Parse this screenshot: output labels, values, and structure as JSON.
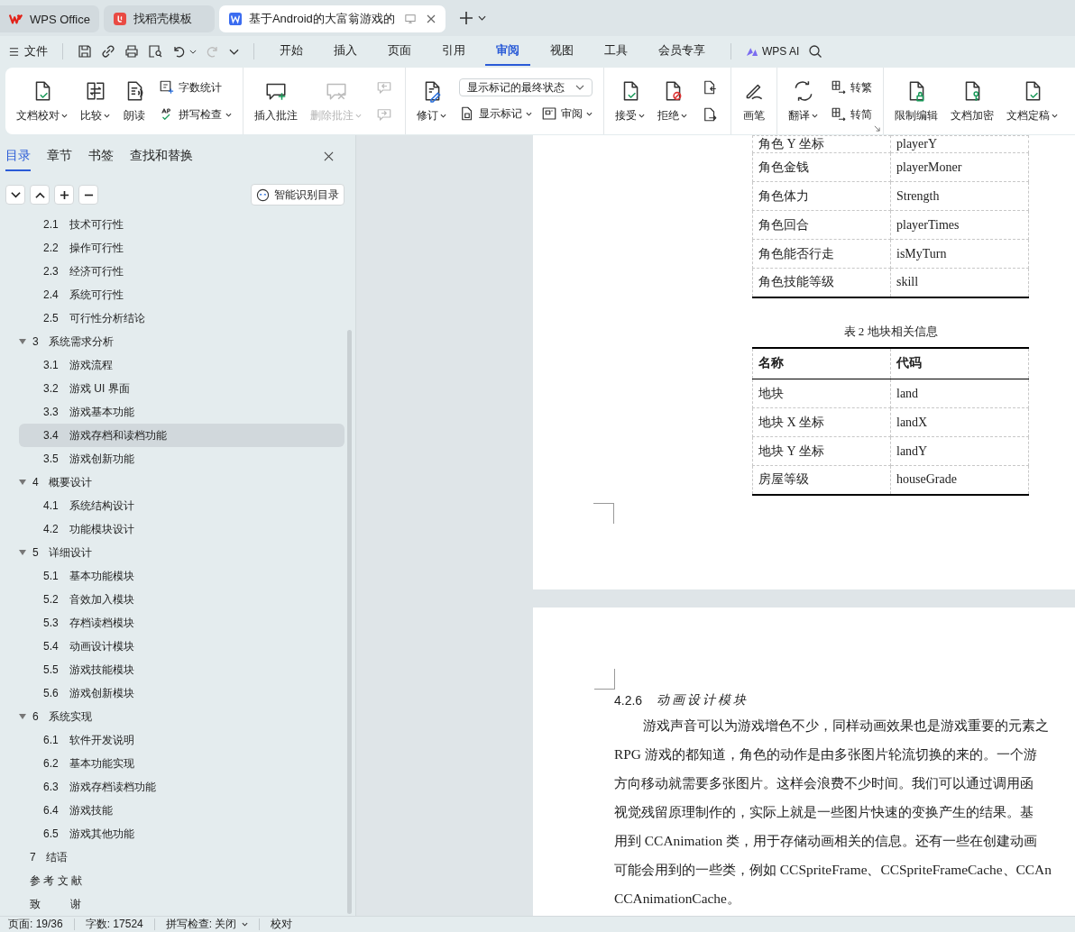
{
  "title_bar": {
    "tabs": [
      {
        "kind": "app",
        "label": "WPS Office",
        "selected": false
      },
      {
        "kind": "template",
        "label": "找稻壳模板",
        "selected": false
      },
      {
        "kind": "document",
        "label": "基于Android的大富翁游戏的",
        "selected": true
      }
    ]
  },
  "menu_bar": {
    "file_label": "文件",
    "tabs": [
      {
        "label": "开始",
        "selected": false
      },
      {
        "label": "插入",
        "selected": false
      },
      {
        "label": "页面",
        "selected": false
      },
      {
        "label": "引用",
        "selected": false
      },
      {
        "label": "审阅",
        "selected": true
      },
      {
        "label": "视图",
        "selected": false
      },
      {
        "label": "工具",
        "selected": false
      },
      {
        "label": "会员专享",
        "selected": false
      }
    ],
    "ai_label": "WPS AI"
  },
  "ribbon": {
    "groups": [
      {
        "items": [
          {
            "kind": "large",
            "label": "文档校对",
            "dropdown": true,
            "disabled": false
          },
          {
            "kind": "large",
            "label": "比较",
            "dropdown": true,
            "disabled": false
          },
          {
            "kind": "large",
            "label": "朗读",
            "dropdown": false,
            "disabled": false
          },
          {
            "kind": "stack",
            "rows": [
              [
                {
                  "kind": "small",
                  "label": "字数统计",
                  "dropdown": false,
                  "disabled": false
                }
              ],
              [
                {
                  "kind": "small",
                  "label": "拼写检查",
                  "dropdown": true,
                  "disabled": false
                }
              ]
            ]
          }
        ]
      },
      {
        "items": [
          {
            "kind": "large",
            "label": "插入批注",
            "dropdown": false,
            "disabled": false
          },
          {
            "kind": "large",
            "label": "删除批注",
            "dropdown": true,
            "disabled": true
          },
          {
            "kind": "stack",
            "rows": [
              [
                {
                  "kind": "icon",
                  "disabled": true
                }
              ],
              [
                {
                  "kind": "icon",
                  "disabled": true
                }
              ]
            ]
          }
        ]
      },
      {
        "items": [
          {
            "kind": "large",
            "label": "修订",
            "dropdown": true,
            "disabled": false
          },
          {
            "kind": "stack",
            "rows": [
              [
                {
                  "kind": "select",
                  "label": "显示标记的最终状态"
                }
              ],
              [
                {
                  "kind": "small",
                  "label": "显示标记",
                  "dropdown": true,
                  "disabled": false
                },
                {
                  "kind": "small",
                  "label": "审阅",
                  "dropdown": true,
                  "disabled": false
                }
              ]
            ]
          }
        ]
      },
      {
        "items": [
          {
            "kind": "large",
            "label": "接受",
            "dropdown": true,
            "disabled": false
          },
          {
            "kind": "large",
            "label": "拒绝",
            "dropdown": true,
            "disabled": false
          },
          {
            "kind": "stack",
            "rows": [
              [
                {
                  "kind": "icon",
                  "disabled": false
                }
              ],
              [
                {
                  "kind": "icon",
                  "disabled": false
                }
              ]
            ]
          }
        ]
      },
      {
        "items": [
          {
            "kind": "large",
            "label": "画笔",
            "dropdown": false,
            "disabled": false
          }
        ]
      },
      {
        "launcher": true,
        "items": [
          {
            "kind": "large",
            "label": "翻译",
            "dropdown": true,
            "disabled": false
          },
          {
            "kind": "stack",
            "rows": [
              [
                {
                  "kind": "small",
                  "label": "转繁",
                  "dropdown": false,
                  "disabled": false
                }
              ],
              [
                {
                  "kind": "small",
                  "label": "转简",
                  "dropdown": false,
                  "disabled": false
                }
              ]
            ]
          }
        ]
      },
      {
        "items": [
          {
            "kind": "large",
            "label": "限制编辑",
            "dropdown": false,
            "disabled": false
          },
          {
            "kind": "large",
            "label": "文档加密",
            "dropdown": false,
            "disabled": false
          },
          {
            "kind": "large",
            "label": "文档定稿",
            "dropdown": true,
            "disabled": false
          }
        ]
      }
    ]
  },
  "sidebar": {
    "tabs": [
      {
        "label": "目录",
        "selected": true
      },
      {
        "label": "章节",
        "selected": false
      },
      {
        "label": "书签",
        "selected": false
      },
      {
        "label": "查找和替换",
        "selected": false
      }
    ],
    "smart_toc_button": "智能识别目录",
    "toc": {
      "orphan_items": [
        {
          "num": "2.1",
          "title": "技术可行性",
          "selected": false
        },
        {
          "num": "2.2",
          "title": "操作可行性",
          "selected": false
        },
        {
          "num": "2.3",
          "title": "经济可行性",
          "selected": false
        },
        {
          "num": "2.4",
          "title": "系统可行性",
          "selected": false
        },
        {
          "num": "2.5",
          "title": "可行性分析结论",
          "selected": false
        }
      ],
      "items": [
        {
          "num": "3",
          "title": "系统需求分析",
          "selected": false,
          "expanded": true,
          "children": [
            {
              "num": "3.1",
              "title": "游戏流程",
              "selected": false
            },
            {
              "num": "3.2",
              "title": "游戏 UI 界面",
              "selected": false
            },
            {
              "num": "3.3",
              "title": "游戏基本功能",
              "selected": false
            },
            {
              "num": "3.4",
              "title": "游戏存档和读档功能",
              "selected": true
            },
            {
              "num": "3.5",
              "title": "游戏创新功能",
              "selected": false
            }
          ]
        },
        {
          "num": "4",
          "title": "概要设计",
          "selected": false,
          "expanded": true,
          "children": [
            {
              "num": "4.1",
              "title": "系统结构设计",
              "selected": false
            },
            {
              "num": "4.2",
              "title": "功能模块设计",
              "selected": false
            }
          ]
        },
        {
          "num": "5",
          "title": "详细设计",
          "selected": false,
          "expanded": true,
          "children": [
            {
              "num": "5.1",
              "title": "基本功能模块",
              "selected": false
            },
            {
              "num": "5.2",
              "title": "音效加入模块",
              "selected": false
            },
            {
              "num": "5.3",
              "title": "存档读档模块",
              "selected": false
            },
            {
              "num": "5.4",
              "title": "动画设计模块",
              "selected": false
            },
            {
              "num": "5.5",
              "title": "游戏技能模块",
              "selected": false
            },
            {
              "num": "5.6",
              "title": "游戏创新模块",
              "selected": false
            }
          ]
        },
        {
          "num": "6",
          "title": "系统实现",
          "selected": false,
          "expanded": true,
          "children": [
            {
              "num": "6.1",
              "title": "软件开发说明",
              "selected": false
            },
            {
              "num": "6.2",
              "title": "基本功能实现",
              "selected": false
            },
            {
              "num": "6.3",
              "title": "游戏存档读档功能",
              "selected": false
            },
            {
              "num": "6.4",
              "title": "游戏技能",
              "selected": false
            },
            {
              "num": "6.5",
              "title": "游戏其他功能",
              "selected": false
            }
          ]
        },
        {
          "num": "7",
          "title": "结语",
          "selected": false
        },
        {
          "title": "参 考 文 献",
          "selected": false
        },
        {
          "title": "致          谢",
          "selected": false
        }
      ]
    }
  },
  "document": {
    "table_1_rows": [
      {
        "name": "角色 Y 坐标",
        "code": "playerY"
      },
      {
        "name": "角色金钱",
        "code": "playerMoner"
      },
      {
        "name": "角色体力",
        "code": "Strength"
      },
      {
        "name": "角色回合",
        "code": "playerTimes"
      },
      {
        "name": "角色能否行走",
        "code": "isMyTurn"
      },
      {
        "name": "角色技能等级",
        "code": "skill"
      }
    ],
    "table_2": {
      "caption": "表 2  地块相关信息",
      "columns": [
        "名称",
        "代码"
      ],
      "rows": [
        {
          "name": "地块",
          "code": "land"
        },
        {
          "name": "地块 X 坐标",
          "code": "landX"
        },
        {
          "name": "地块 Y 坐标",
          "code": "landY"
        },
        {
          "name": "房屋等级",
          "code": "houseGrade"
        }
      ]
    },
    "section_number": "4.2.6",
    "section_title": "动画设计模块",
    "paragraph_lines": [
      "游戏声音可以为游戏增色不少，同样动画效果也是游戏重要的元素之",
      "RPG 游戏的都知道，角色的动作是由多张图片轮流切换的来的。一个游",
      "方向移动就需要多张图片。这样会浪费不少时间。我们可以通过调用函",
      "视觉残留原理制作的，实际上就是一些图片快速的变换产生的结果。基",
      "用到 CCAnimation 类，用于存储动画相关的信息。还有一些在创建动画",
      "可能会用到的一些类，例如 CCSpriteFrame、CCSpriteFrameCache、CCAn",
      "CCAnimationCache。"
    ]
  },
  "status_bar": [
    {
      "kind": "text",
      "label": "页面: 19/36"
    },
    {
      "kind": "text",
      "label": "字数: 17524"
    },
    {
      "kind": "dropdown",
      "label": "拼写检查: 关闭"
    },
    {
      "kind": "text",
      "label": "校对"
    }
  ]
}
